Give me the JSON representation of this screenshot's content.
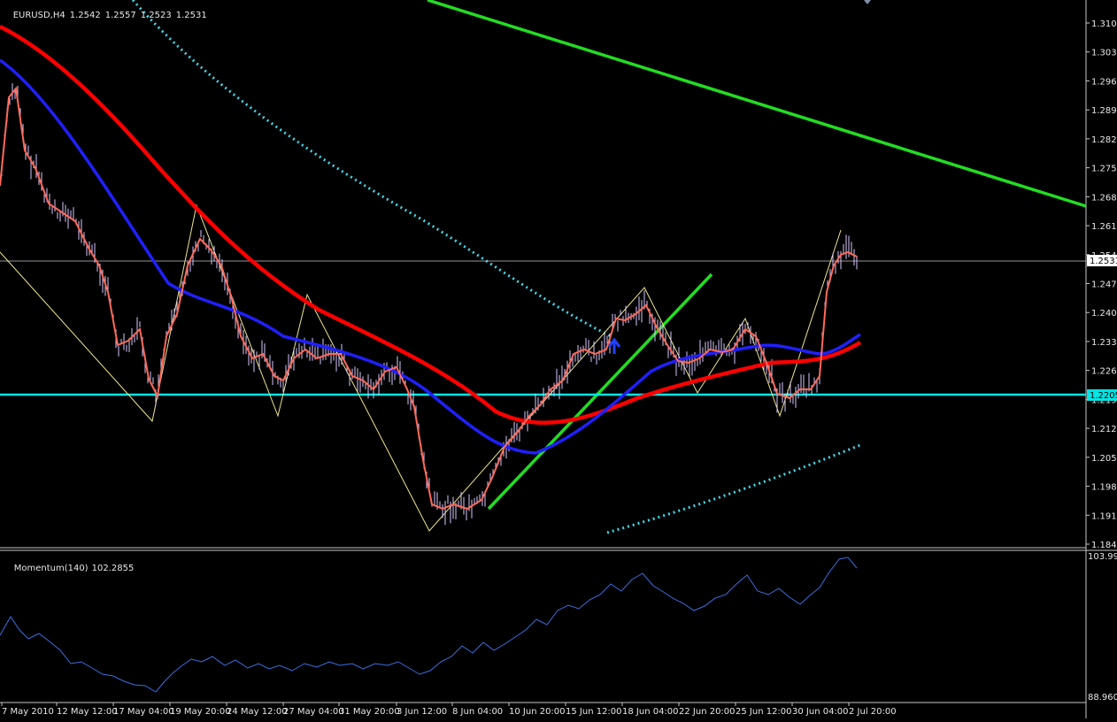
{
  "header": {
    "symbol": "EURUSD,H4",
    "open": "1.2542",
    "high": "1.2557",
    "low": "1.2523",
    "close": "1.2531"
  },
  "price_axis": {
    "ticks": [
      "1.3105",
      "1.3035",
      "1.2965",
      "1.2895",
      "1.2825",
      "1.2755",
      "1.2685",
      "1.2615",
      "1.2545",
      "1.2475",
      "1.2405",
      "1.2335",
      "1.2265",
      "1.2195",
      "1.2125",
      "1.2055",
      "1.1985",
      "1.1915",
      "1.1845"
    ],
    "current_price_label": "1.2531",
    "level_label": "1.2205"
  },
  "time_axis": {
    "labels": [
      "7 May 2010",
      "12 May 12:00",
      "17 May 04:00",
      "19 May 20:00",
      "24 May 12:00",
      "27 May 04:00",
      "31 May 20:00",
      "3 Jun 12:00",
      "8 Jun 04:00",
      "10 Jun 20:00",
      "15 Jun 12:00",
      "18 Jun 04:00",
      "22 Jun 20:00",
      "25 Jun 12:00",
      "30 Jun 04:00",
      "2 Jul 20:00"
    ]
  },
  "indicator": {
    "name": "Momentum(140)",
    "value": "102.2855",
    "axis_max": "103.994",
    "axis_min": "88.9608"
  },
  "colors": {
    "background": "#000000",
    "axis_text": "#e8e8e8",
    "price_line": "#c8c8c8",
    "level_line": "#00e5e5",
    "ma_red": "#ff0000",
    "ma_blue": "#2020ff",
    "fast_ma": "#ff6a5a",
    "trendline": "#22dd22",
    "zigzag": "#f0e68c",
    "dotted_channel": "#40d8e8",
    "momentum_line": "#3b6fe0",
    "candles": "#d8c8ff"
  }
}
